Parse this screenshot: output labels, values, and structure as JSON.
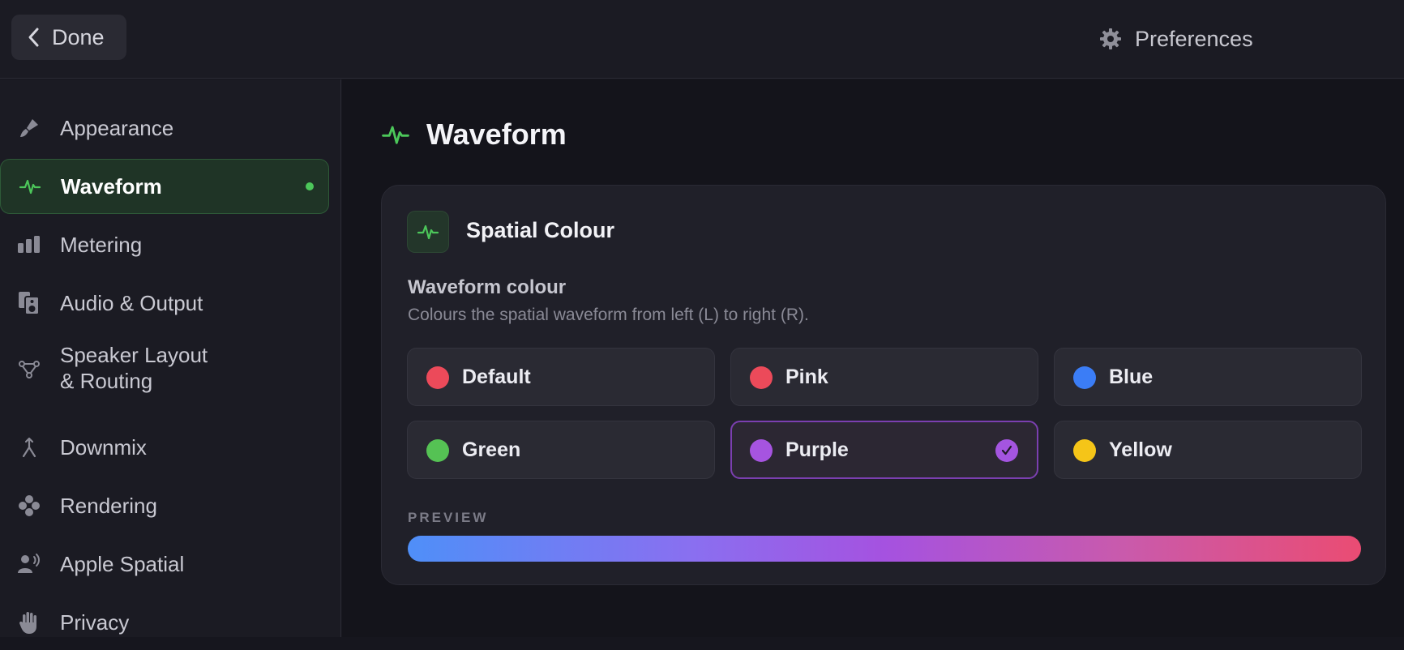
{
  "topbar": {
    "done_label": "Done",
    "preferences_label": "Preferences"
  },
  "sidebar": {
    "items": [
      {
        "label": "Appearance",
        "icon": "brush-icon"
      },
      {
        "label": "Waveform",
        "icon": "waveform-icon",
        "active": true
      },
      {
        "label": "Metering",
        "icon": "meter-bars-icon"
      },
      {
        "label": "Audio & Output",
        "icon": "speaker-icon"
      },
      {
        "label_line1": "Speaker Layout",
        "label_line2": "& Routing",
        "icon": "routing-nodes-icon"
      },
      {
        "label": "Downmix",
        "icon": "merge-arrow-icon"
      },
      {
        "label": "Rendering",
        "icon": "dots-cluster-icon"
      },
      {
        "label": "Apple Spatial",
        "icon": "person-wave-icon"
      },
      {
        "label": "Privacy",
        "icon": "hand-icon"
      }
    ]
  },
  "main": {
    "title": "Waveform",
    "card": {
      "title": "Spatial Colour",
      "field_label": "Waveform colour",
      "field_description": "Colours the spatial waveform from left (L) to right (R).",
      "options": [
        {
          "name": "Default",
          "color": "#ec4a5a"
        },
        {
          "name": "Pink",
          "color": "#ec4a5a"
        },
        {
          "name": "Blue",
          "color": "#3b7df6"
        },
        {
          "name": "Green",
          "color": "#55c254"
        },
        {
          "name": "Purple",
          "color": "#a654e0",
          "selected": true
        },
        {
          "name": "Yellow",
          "color": "#f5c518"
        }
      ],
      "preview_label": "PREVIEW"
    }
  },
  "colors": {
    "accent_green": "#4cc75a",
    "accent_purple": "#a455e0",
    "gradient_start": "#4f8ff8",
    "gradient_mid": "#a552e0",
    "gradient_end": "#ea4c73"
  }
}
